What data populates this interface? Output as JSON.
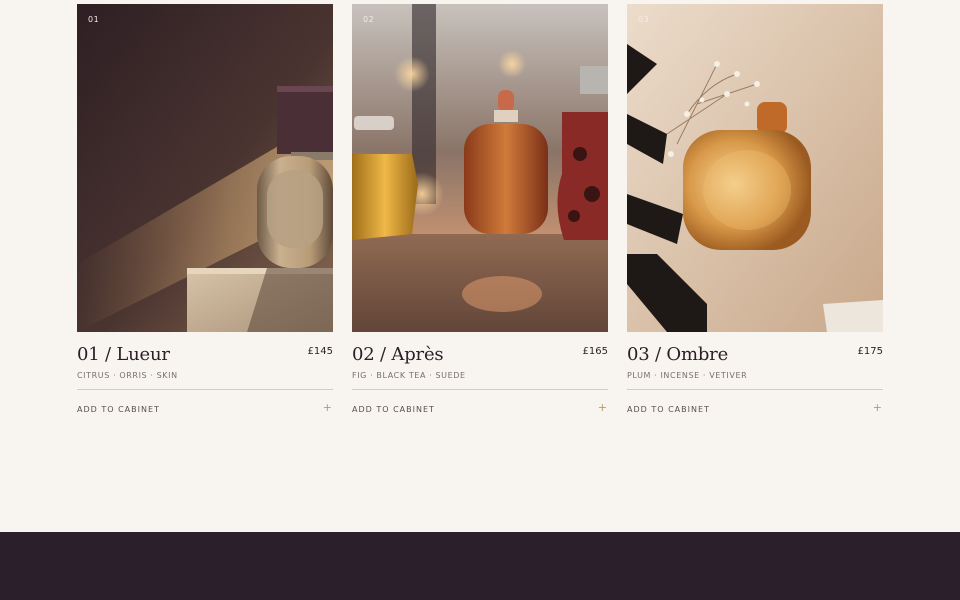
{
  "products": [
    {
      "index": "01",
      "title": "01 / Lueur",
      "price": "£145",
      "notes": "CITRUS · ORRIS · SKIN",
      "cta": "ADD TO CABINET",
      "cta_icon": "+",
      "image": "amber-perfume-bottle-on-stone-pedestal"
    },
    {
      "index": "02",
      "title": "02 / Après",
      "price": "£165",
      "notes": "FIG · BLACK TEA · SUEDE",
      "cta": "ADD TO CABINET",
      "cta_icon": "+",
      "image": "row-of-perfume-bottles-on-table"
    },
    {
      "index": "03",
      "title": "03 / Ombre",
      "price": "£175",
      "notes": "PLUM · INCENSE · VETIVER",
      "cta": "ADD TO CABINET",
      "cta_icon": "+",
      "image": "perfume-bottle-with-dried-flowers-on-magazine"
    }
  ],
  "colors": {
    "background": "#f8f4ef",
    "footer": "#2a1f2a",
    "accent": "#b49a6e",
    "text": "#2a1f26",
    "muted": "#7a7068"
  }
}
